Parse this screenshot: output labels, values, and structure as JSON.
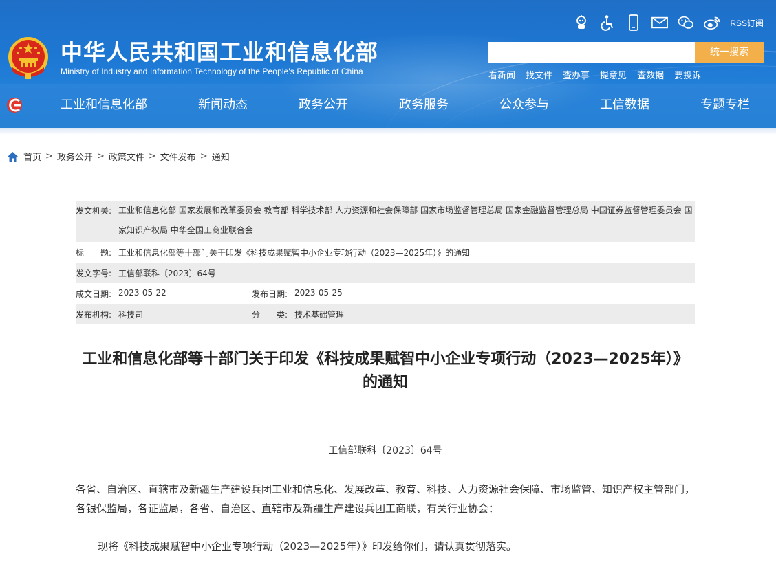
{
  "header": {
    "site_title": "中华人民共和国工业和信息化部",
    "site_subtitle": "Ministry of Industry and Information Technology of the People's Republic of China",
    "emblem_icon": "national-emblem-icon",
    "toolbar_icons": [
      "robot-assistant-icon",
      "accessibility-icon",
      "mobile-icon",
      "mail-icon",
      "wechat-icon",
      "weibo-icon"
    ],
    "rss_label": "RSS订阅",
    "search": {
      "placeholder": "",
      "button_label": "统一搜索"
    },
    "quick_links": [
      "看新闻",
      "找文件",
      "查办事",
      "提意见",
      "查数据",
      "要投诉"
    ],
    "nav": [
      "工业和信息化部",
      "新闻动态",
      "政务公开",
      "政务服务",
      "公众参与",
      "工信数据",
      "专题专栏"
    ],
    "colors": {
      "header_blue": "#1d78d3",
      "search_button": "#f3b04a",
      "emblem_red": "#d8281c",
      "emblem_gold": "#f5c22d"
    }
  },
  "breadcrumb": [
    "首页",
    "政务公开",
    "政策文件",
    "文件发布",
    "通知"
  ],
  "meta": {
    "issuer_label": "发文机关:",
    "issuer_value": "工业和信息化部 国家发展和改革委员会 教育部 科学技术部 人力资源和社会保障部 国家市场监督管理总局 国家金融监督管理总局 中国证券监督管理委员会 国家知识产权局 中华全国工商业联合会",
    "title_label": "标　　题:",
    "title_value": "工业和信息化部等十部门关于印发《科技成果赋智中小企业专项行动（2023—2025年）》的通知",
    "docno_label": "发文字号:",
    "docno_value": "工信部联科〔2023〕64号",
    "written_label": "成文日期:",
    "written_value": "2023-05-22",
    "published_label": "发布日期:",
    "published_value": "2023-05-25",
    "agency_label": "发布机构:",
    "agency_value": "科技司",
    "category_label": "分　　类:",
    "category_value": "技术基础管理"
  },
  "article": {
    "title": "工业和信息化部等十部门关于印发《科技成果赋智中小企业专项行动（2023—2025年）》的通知",
    "doc_number": "工信部联科〔2023〕64号",
    "para1": "各省、自治区、直辖市及新疆生产建设兵团工业和信息化、发展改革、教育、科技、人力资源社会保障、市场监管、知识产权主管部门，各银保监局，各证监局，各省、自治区、直辖市及新疆生产建设兵团工商联，有关行业协会：",
    "para2": "现将《科技成果赋智中小企业专项行动（2023—2025年）》印发给你们，请认真贯彻落实。"
  }
}
